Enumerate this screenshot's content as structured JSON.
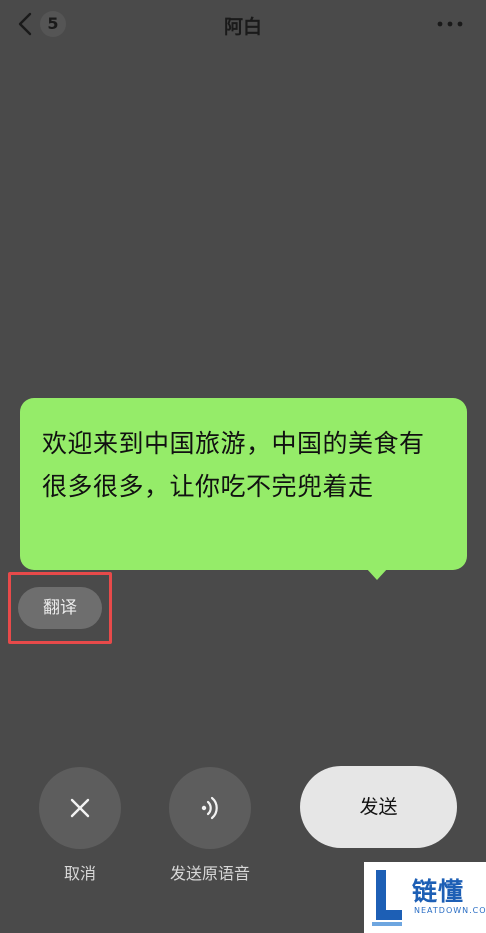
{
  "header": {
    "unread_count": "5",
    "title": "阿白",
    "back_icon": "chevron-left-icon",
    "more_icon": "more-dots-icon"
  },
  "message": {
    "text": "欢迎来到中国旅游，中国的美食有很多很多，让你吃不完兜着走",
    "bubble_color": "#95ec69"
  },
  "translate": {
    "label": "翻译",
    "highlight_color": "#e84a4a"
  },
  "actions": {
    "cancel_label": "取消",
    "cancel_icon": "close-icon",
    "send_voice_label": "发送原语音",
    "send_voice_icon": "sound-wave-icon",
    "send_label": "发送"
  },
  "watermark": {
    "name": "链懂",
    "domain": "NEATDOWN.COM"
  },
  "colors": {
    "background": "#4a4a4a",
    "send_button": "#e6e6e6"
  }
}
